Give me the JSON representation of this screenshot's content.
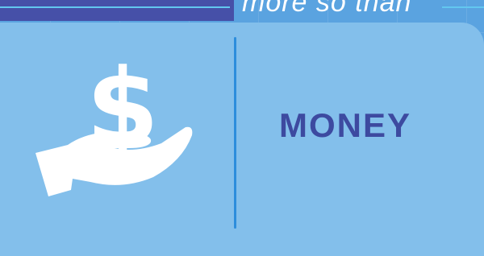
{
  "banner": {
    "text": "more so than"
  },
  "card": {
    "icon": "hand-holding-dollar-icon",
    "label": "MONEY"
  },
  "colors": {
    "background": "#5aa3e0",
    "panel": "#83bfeb",
    "band": "#4650a8",
    "label": "#3d4aa0",
    "divider": "#2d8ddc",
    "accent_line": "#63c7ef"
  }
}
